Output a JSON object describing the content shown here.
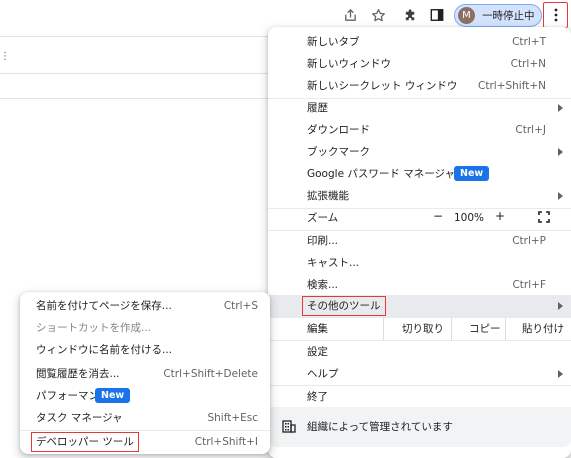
{
  "toolbar": {
    "profile_initial": "M",
    "profile_label": "一時停止中"
  },
  "menu": {
    "items": [
      {
        "label": "新しいタブ",
        "shortcut": "Ctrl+T"
      },
      {
        "label": "新しいウィンドウ",
        "shortcut": "Ctrl+N"
      },
      {
        "label": "新しいシークレット ウィンドウ",
        "shortcut": "Ctrl+Shift+N"
      },
      {
        "label": "履歴"
      },
      {
        "label": "ダウンロード",
        "shortcut": "Ctrl+J"
      },
      {
        "label": "ブックマーク"
      },
      {
        "label": "Google パスワード マネージャー",
        "badge": "New"
      },
      {
        "label": "拡張機能"
      },
      {
        "label": "ズーム"
      },
      {
        "label": "印刷...",
        "shortcut": "Ctrl+P"
      },
      {
        "label": "キャスト..."
      },
      {
        "label": "検索...",
        "shortcut": "Ctrl+F"
      },
      {
        "label": "その他のツール"
      },
      {
        "label": "編集"
      },
      {
        "label": "設定"
      },
      {
        "label": "ヘルプ"
      },
      {
        "label": "終了"
      }
    ],
    "zoom": {
      "minus": "−",
      "value": "100%",
      "plus": "+"
    },
    "edit": {
      "cut": "切り取り",
      "copy": "コピー",
      "paste": "貼り付け"
    },
    "managed": "組織によって管理されています"
  },
  "submenu": {
    "items": [
      {
        "label": "名前を付けてページを保存...",
        "shortcut": "Ctrl+S"
      },
      {
        "label": "ショートカットを作成..."
      },
      {
        "label": "ウィンドウに名前を付ける..."
      },
      {
        "label": "閲覧履歴を消去...",
        "shortcut": "Ctrl+Shift+Delete"
      },
      {
        "label": "パフォーマンス",
        "badge": "New"
      },
      {
        "label": "タスク マネージャ",
        "shortcut": "Shift+Esc"
      },
      {
        "label": "デベロッパー ツール",
        "shortcut": "Ctrl+Shift+I"
      }
    ]
  },
  "colors": {
    "highlight_box": "#e53935",
    "new_badge": "#1a73e8",
    "profile_pill": "#d3e3fd",
    "hover_row": "#e8eaed"
  },
  "icons": {
    "share": "share-icon",
    "bookmark": "star-icon",
    "extensions": "puzzle-icon",
    "side_panel": "side-panel-icon",
    "menu": "kebab-menu-icon",
    "fullscreen": "fullscreen-icon",
    "managed": "building-icon"
  }
}
